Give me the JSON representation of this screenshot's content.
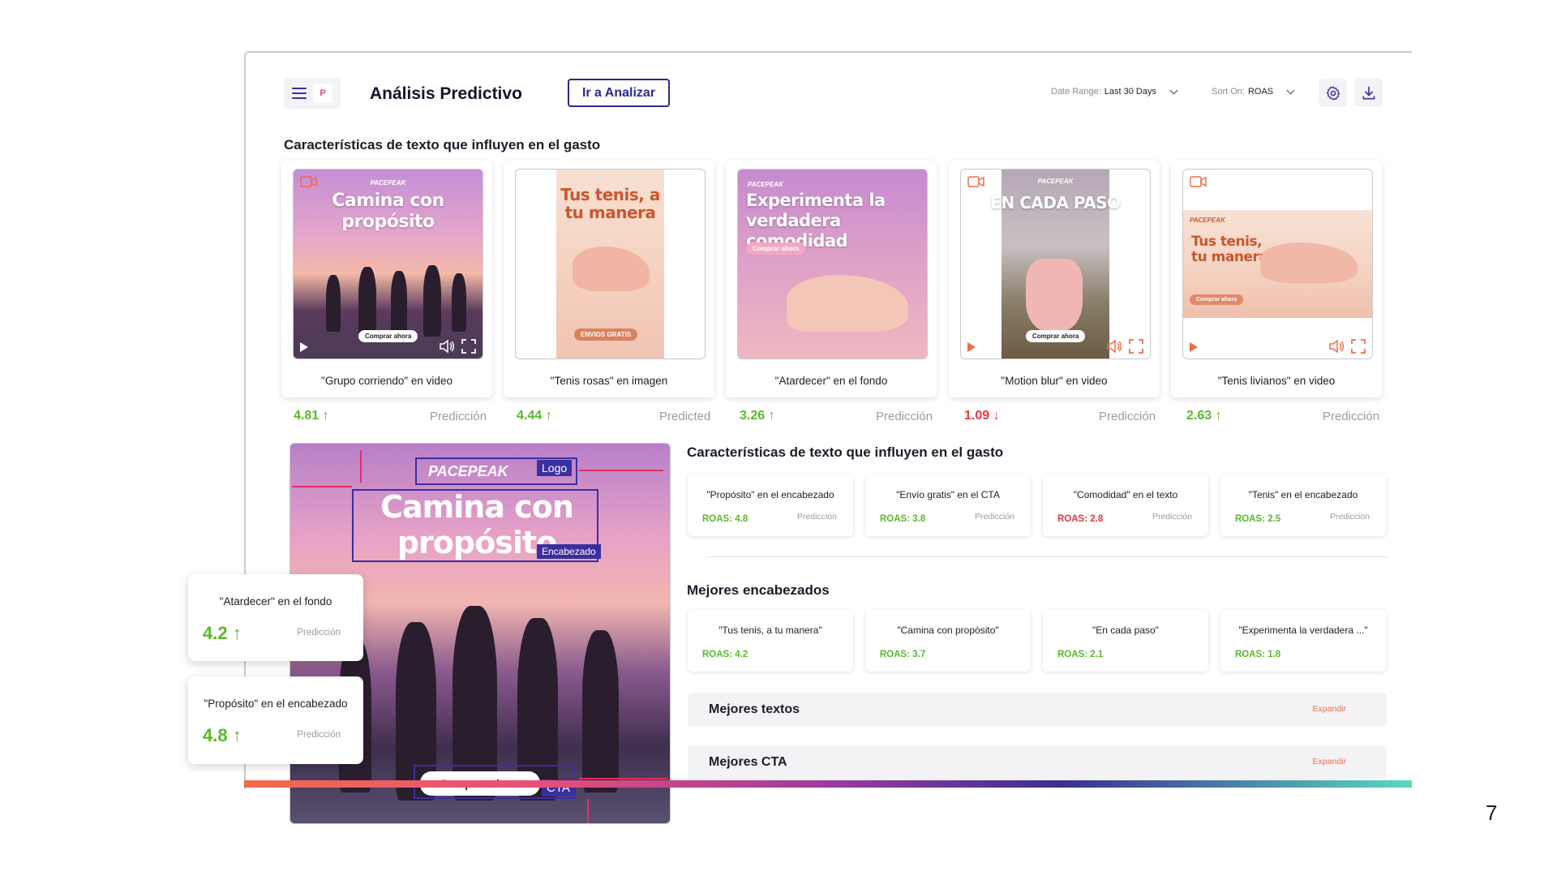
{
  "header": {
    "badge": "P",
    "title": "Análisis Predictivo",
    "analyze_button": "Ir a Analizar",
    "date_range_label": "Date Range:",
    "date_range_value": "Last 30 Days",
    "sort_label": "Sort On:",
    "sort_value": "ROAS",
    "icons": [
      "menu-icon",
      "gear-icon",
      "download-icon"
    ]
  },
  "section1_title": "Características de texto que influyen en el gasto",
  "creatives": [
    {
      "headline": "Camina con propósito",
      "brand": "PACEPEAK",
      "cta": "Comprar ahora",
      "label": "\"Grupo corriendo\" en video",
      "score": "4.81",
      "trend": "↑",
      "pred": "Predicción",
      "type": "video"
    },
    {
      "headline": "Tus tenis, a tu manera",
      "brand": "",
      "cta": "ENVIOS GRATIS",
      "label": "\"Tenis rosas\" en imagen",
      "score": "4.44",
      "trend": "↑",
      "pred": "Predicted",
      "type": "image"
    },
    {
      "headline": "Experimenta la verdadera comodidad",
      "brand": "PACEPEAK",
      "cta": "Comprar ahora",
      "label": "\"Atardecer\" en el fondo",
      "score": "3.26",
      "trend": "↑",
      "pred": "Predicción",
      "type": "image"
    },
    {
      "headline": "EN CADA PASO",
      "brand": "PACEPEAK",
      "cta": "Comprar ahora",
      "label": "\"Motion blur\" en video",
      "score": "1.09",
      "trend": "↓",
      "pred": "Predicción",
      "type": "video"
    },
    {
      "headline": "Tus tenis, tu manera",
      "brand": "PACEPEAK",
      "cta": "Comprar ahora",
      "label": "\"Tenis livianos\" en video",
      "score": "2.63",
      "trend": "↑",
      "pred": "Predicción",
      "type": "video"
    }
  ],
  "preview": {
    "brand": "PACEPEAK",
    "headline": "Camina con propósito",
    "cta": "Comprar ahora",
    "tags": {
      "logo": "Logo",
      "headline": "Encabezado",
      "cta": "CTA"
    }
  },
  "float_cards": [
    {
      "title": "\"Atardecer\" en el fondo",
      "value": "4.2 ↑",
      "pred": "Predicción"
    },
    {
      "title": "\"Propósito\" en el encabezado",
      "value": "4.8 ↑",
      "pred": "Predicción"
    }
  ],
  "section2_title": "Características de texto que influyen en el gasto",
  "features": [
    {
      "text": "\"Propósito\" en el encabezado",
      "roas": "ROAS:  4.8",
      "pred": "Predicción",
      "color": "#5ab82a"
    },
    {
      "text": "\"Envío gratis\" en el CTA",
      "roas": "ROAS:  3.8",
      "pred": "Predicción",
      "color": "#5ab82a"
    },
    {
      "text": "\"Comodidad\" en el texto",
      "roas": "ROAS:  2.8",
      "pred": "Predicción",
      "color": "#e5353e"
    },
    {
      "text": "\"Tenis\" en el encabezado",
      "roas": "ROAS:  2.5",
      "pred": "Predicción",
      "color": "#5ab82a"
    }
  ],
  "section3_title": "Mejores encabezados",
  "headlines": [
    {
      "text": "\"Tus tenis, a tu manera\"",
      "roas": "ROAS:  4.2"
    },
    {
      "text": "\"Camina con propósito\"",
      "roas": "ROAS:  3.7"
    },
    {
      "text": "\"En cada paso\"",
      "roas": "ROAS:  2.1"
    },
    {
      "text": "\"Experimenta la verdadera ...\"",
      "roas": "ROAS:  1.8"
    }
  ],
  "accordions": [
    {
      "title": "Mejores textos",
      "action": "Expandir"
    },
    {
      "title": "Mejores CTA",
      "action": "Expandir"
    }
  ],
  "page_number": "7"
}
